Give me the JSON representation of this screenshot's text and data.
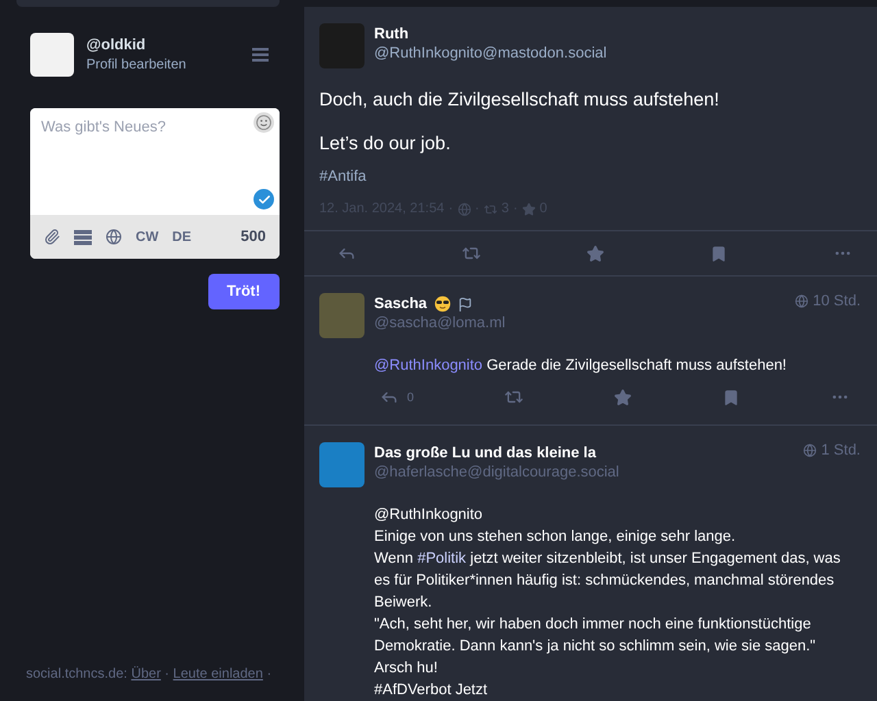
{
  "account": {
    "handle": "@oldkid",
    "edit_link": "Profil bearbeiten"
  },
  "compose": {
    "placeholder": "Was gibt's Neues?",
    "tools": [
      "CW",
      "DE"
    ],
    "char_count": "500",
    "submit": "Tröt!"
  },
  "footer": [
    {
      "kind": "text",
      "text": "social.tchncs.de: "
    },
    {
      "kind": "link",
      "text": "Über"
    },
    {
      "kind": "text",
      "text": " · "
    },
    {
      "kind": "link",
      "text": "Leute einladen"
    },
    {
      "kind": "text",
      "text": " ·"
    }
  ],
  "posts": [
    {
      "kind": "focused",
      "name": "Ruth",
      "handle": "@RuthInkognito@mastodon.social",
      "lines": [
        [
          {
            "kind": "text",
            "text": "Doch, auch die Zivilgesellschaft muss aufstehen!"
          }
        ],
        [
          {
            "kind": "text",
            "text": "Let’s do our job."
          }
        ]
      ],
      "tags": "#Antifa",
      "separator": "·",
      "date": "12. Jan. 2024, 21:54",
      "boosts": "3",
      "favourites": "0",
      "actions": true
    },
    {
      "kind": "reply",
      "name": "Sascha",
      "handle": "@sascha@loma.ml",
      "time": "10 Std.",
      "replies": "0",
      "actions": true,
      "lines": [
        [
          {
            "kind": "link",
            "text": "@RuthInkognito"
          },
          {
            "kind": "text",
            "text": " Gerade die Zivilgesellschaft muss aufstehen!"
          }
        ]
      ]
    },
    {
      "kind": "reply",
      "name": "Das große Lu und das kleine la",
      "handle": "@haferlasche@digitalcourage.social",
      "time": "1 Std.",
      "lines": [
        [
          {
            "kind": "text",
            "text": "@RuthInkognito"
          }
        ],
        [
          {
            "kind": "text",
            "text": "Einige von uns stehen schon lange, einige sehr lange."
          }
        ],
        [
          {
            "kind": "text",
            "text": "Wenn "
          },
          {
            "kind": "link",
            "text": "#Politik"
          },
          {
            "kind": "text",
            "text": " jetzt weiter sitzenbleibt, ist unser Engagement das, was es für Politiker*innen häufig ist: schmückendes, manchmal störendes Beiwerk."
          }
        ],
        [
          {
            "kind": "text",
            "text": "\"Ach, seht her, wir haben doch immer noch eine funktionstüchtige Demokratie. Dann kann's ja nicht so schlimm sein, wie sie sagen.\""
          }
        ],
        [
          {
            "kind": "text",
            "text": "Arsch hu!"
          }
        ],
        [
          {
            "kind": "text",
            "text": "#AfDVerbot Jetzt"
          }
        ]
      ]
    }
  ]
}
